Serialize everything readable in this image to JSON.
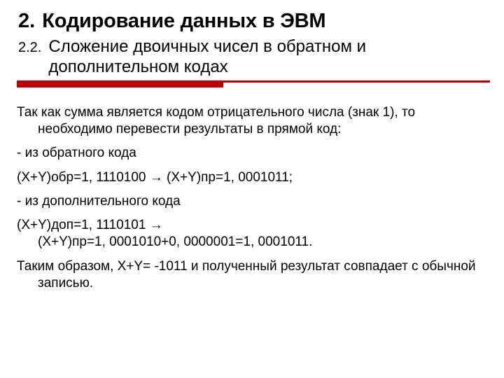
{
  "header": {
    "section_number": "2.",
    "section_title": "Кодирование данных в ЭВМ",
    "subsection_number": "2.2.",
    "subsection_title": "Сложение двоичных чисел в обратном и дополнительном кодах"
  },
  "accent_color": "#c00000",
  "body": {
    "p1": "Так как сумма является кодом отрицательного числа (знак 1), то необходимо перевести результаты в прямой код:",
    "p2": "- из обратного кода",
    "p3_left": "(Х+Y)обр=1, 1110100",
    "p3_arrow": "→",
    "p3_right": " (Х+Y)пр=1, 0001011;",
    "p4": "- из дополнительного кода",
    "p5_left": "(Х+Y)доп=1, 1110101",
    "p5_arrow": "→",
    "p5_rest": "(X+Y)пр=1, 0001010+0, 0000001=1, 0001011.",
    "p6": "Таким образом, X+Y= -1011 и полученный результат совпадает с обычной записью."
  }
}
